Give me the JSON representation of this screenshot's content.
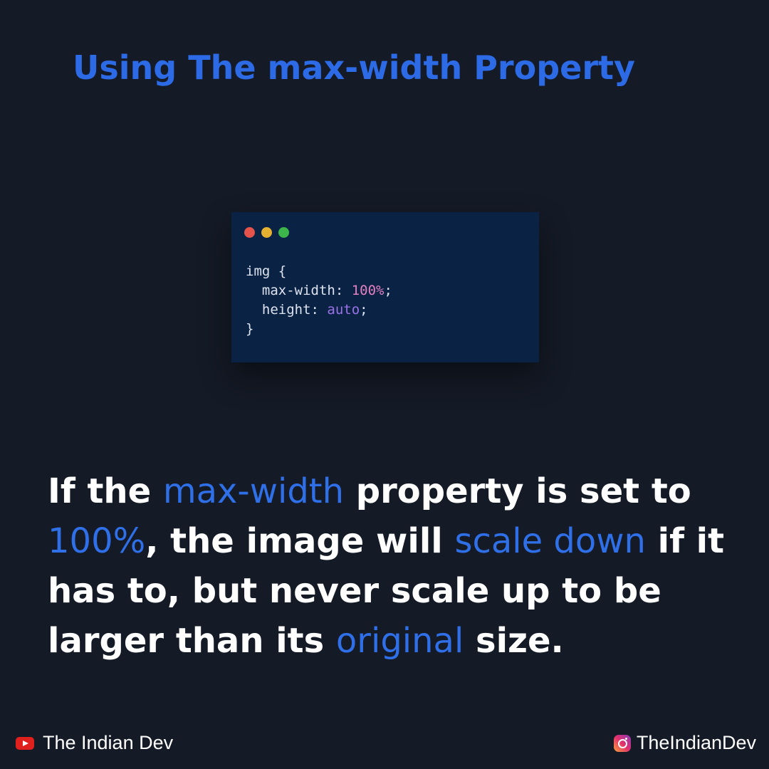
{
  "title": "Using The max-width Property",
  "code_window": {
    "dot_colors": [
      "#e5534b",
      "#e6b030",
      "#3cb54a"
    ],
    "lines": {
      "l1": "img {",
      "l2_prop": "  max-width: ",
      "l2_value": "100%",
      "l2_end": ";",
      "l3_prop": "  height: ",
      "l3_value": "auto",
      "l3_end": ";",
      "l4": "}"
    }
  },
  "body": {
    "t1": "If the ",
    "h1": "max-width",
    "t2": " property is set to ",
    "h2": "100%",
    "t3": ", the image will ",
    "h3": "scale down",
    "t4": " if it has to, but never scale up to be larger than its ",
    "h4": "original",
    "t5": " size."
  },
  "footer": {
    "youtube_icon": "youtube-icon",
    "youtube_label": "The Indian Dev",
    "instagram_icon": "instagram-icon",
    "instagram_label": "TheIndianDev"
  },
  "colors": {
    "background": "#141a26",
    "accent": "#2c6ae6",
    "code_bg": "#0a2244"
  }
}
